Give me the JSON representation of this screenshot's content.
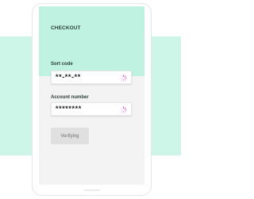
{
  "checkout": {
    "title": "CHECKOUT",
    "sort_code": {
      "label": "Sort code",
      "value": "**-**-**",
      "status_icon": "loading-spinner-icon"
    },
    "account_number": {
      "label": "Account number",
      "value": "********",
      "status_icon": "loading-spinner-icon"
    },
    "verify_button": {
      "label": "Verifying",
      "state": "disabled"
    }
  },
  "colors": {
    "background_band": "#cdf5e8",
    "header_mint": "#bff2e1",
    "screen_background": "#f3f3f3",
    "spinner_accent": "#e040c8",
    "button_disabled": "#e0e0e0"
  }
}
